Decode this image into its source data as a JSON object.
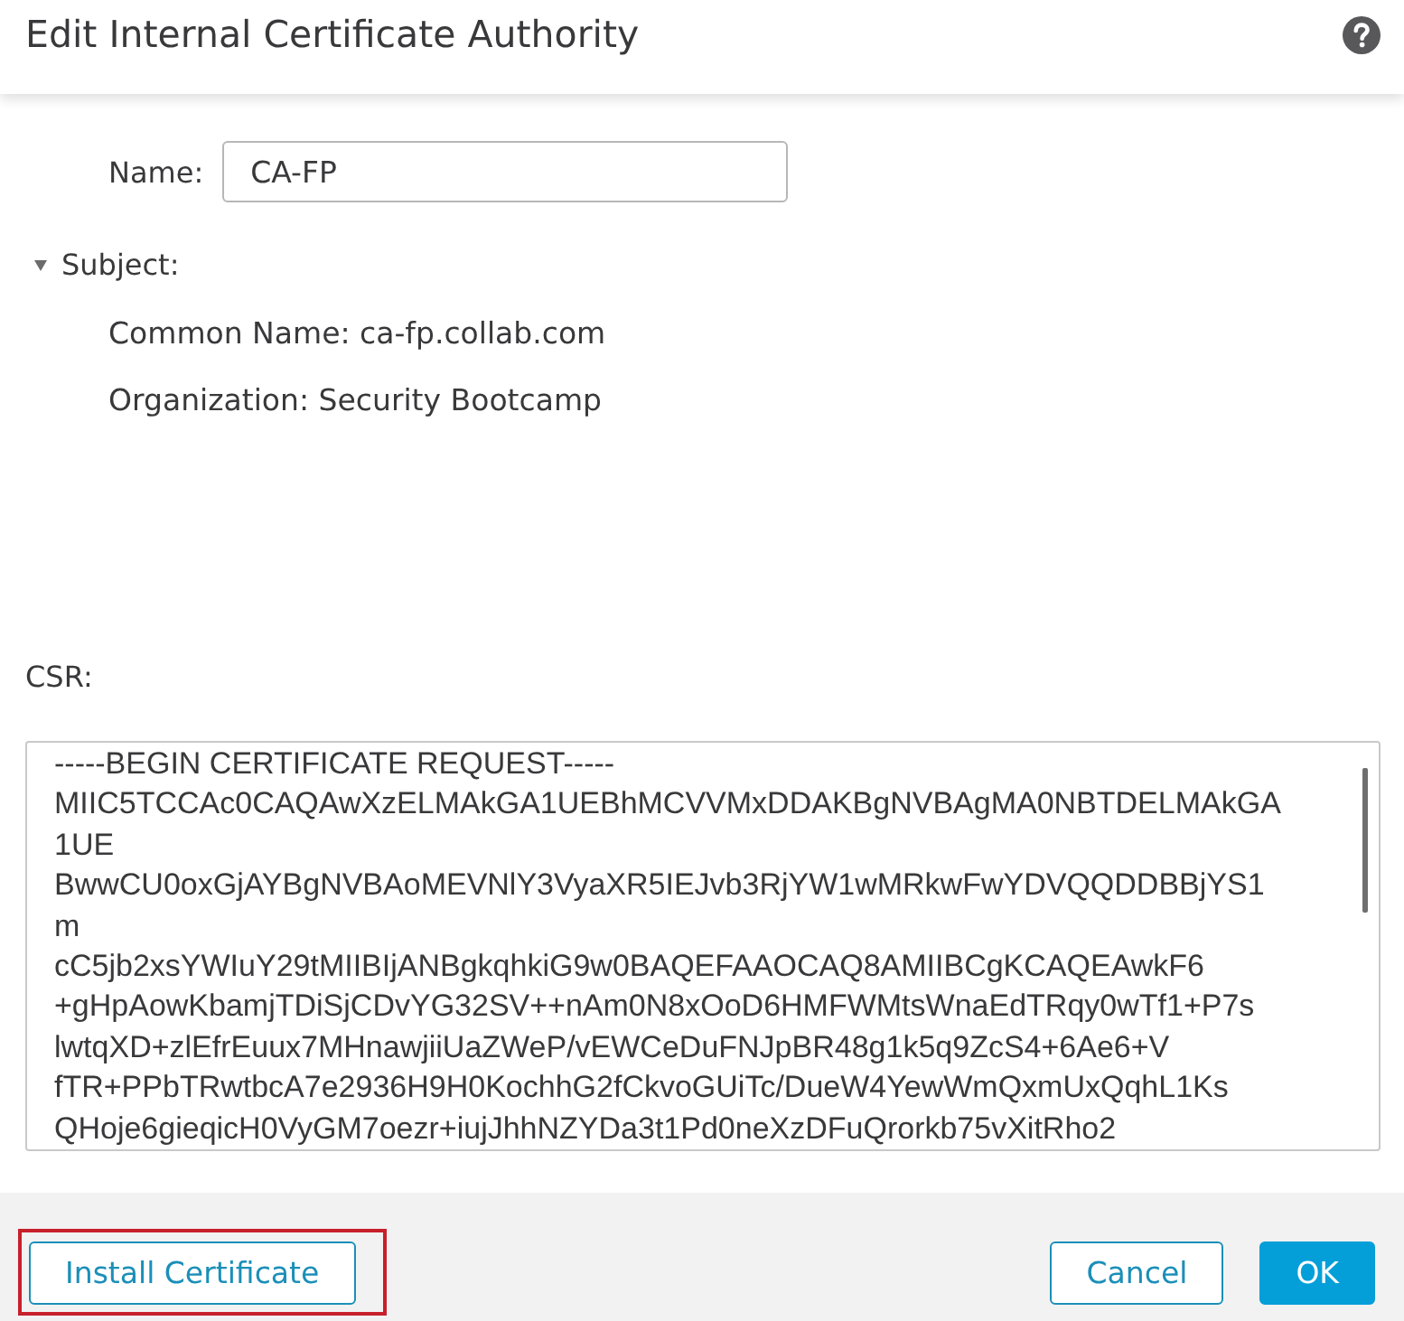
{
  "dialog": {
    "title": "Edit Internal Certificate Authority"
  },
  "name_field": {
    "label": "Name:",
    "value": "CA-FP"
  },
  "subject": {
    "label": "Subject:",
    "expanded": true,
    "fields": [
      "Common Name: ca-fp.collab.com",
      "Organization: Security Bootcamp"
    ]
  },
  "csr": {
    "label": "CSR:",
    "lines": [
      "-----BEGIN CERTIFICATE REQUEST-----",
      "MIIC5TCCAc0CAQAwXzELMAkGA1UEBhMCVVMxDDAKBgNVBAgMA0NBTDELMAkGA",
      "1UE",
      "BwwCU0oxGjAYBgNVBAoMEVNlY3VyaXR5IEJvb3RjYW1wMRkwFwYDVQQDDBBjYS1",
      "m",
      "cC5jb2xsYWIuY29tMIIBIjANBgkqhkiG9w0BAQEFAAOCAQ8AMIIBCgKCAQEAwkF6",
      "+gHpAowKbamjTDiSjCDvYG32SV++nAm0N8xOoD6HMFWMtsWnaEdTRqy0wTf1+P7s",
      "lwtqXD+zlEfrEuux7MHnawjiiUaZWeP/vEWCeDuFNJpBR48g1k5q9ZcS4+6Ae6+V",
      "fTR+PPbTRwtbcA7e2936H9H0KochhG2fCkvoGUiTc/DueW4YewWmQxmUxQqhL1Ks",
      "QHoje6gieqicH0VyGM7oezr+iujJhhNZYDa3t1Pd0neXzDFuQrorkb75vXitRho2"
    ]
  },
  "footer": {
    "left_buttons": [
      {
        "label": "Install Certificate",
        "kind": "secondary",
        "highlighted": true
      }
    ],
    "right_buttons": [
      {
        "label": "Cancel",
        "kind": "secondary",
        "highlighted": false
      },
      {
        "label": "OK",
        "kind": "primary",
        "highlighted": false
      }
    ]
  }
}
